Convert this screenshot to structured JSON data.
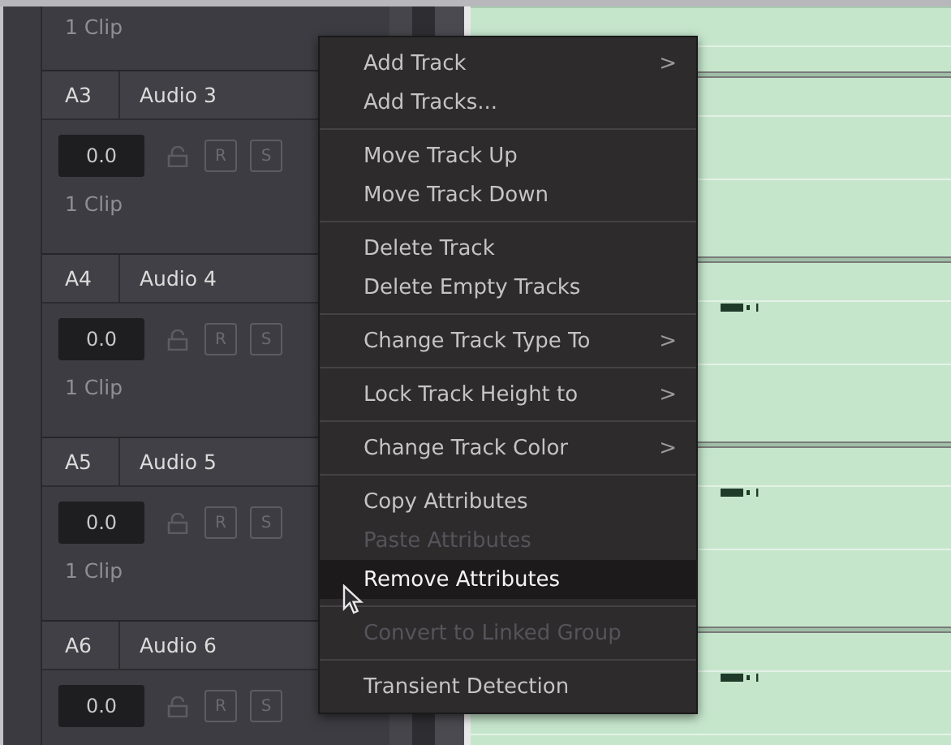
{
  "tracks": [
    {
      "clips": "1 Clip",
      "waveform": false
    },
    {
      "id": "A3",
      "name": "Audio 3",
      "volume": "0.0",
      "buttons": [
        "R",
        "S"
      ],
      "clips": "1 Clip",
      "waveform": false
    },
    {
      "id": "A4",
      "name": "Audio 4",
      "volume": "0.0",
      "buttons": [
        "R",
        "S"
      ],
      "clips": "1 Clip",
      "waveform": true
    },
    {
      "id": "A5",
      "name": "Audio 5",
      "volume": "0.0",
      "buttons": [
        "R",
        "S"
      ],
      "clips": "1 Clip",
      "waveform": true
    },
    {
      "id": "A6",
      "name": "Audio 6",
      "volume": "0.0",
      "buttons": [
        "R",
        "S"
      ],
      "waveform": true
    }
  ],
  "context_menu": {
    "groups": [
      [
        {
          "label": "Add Track",
          "submenu": ">",
          "disabled": false,
          "selected": false
        },
        {
          "label": "Add Tracks...",
          "disabled": false,
          "selected": false
        }
      ],
      [
        {
          "label": "Move Track Up",
          "disabled": false,
          "selected": false
        },
        {
          "label": "Move Track Down",
          "disabled": false,
          "selected": false
        }
      ],
      [
        {
          "label": "Delete Track",
          "disabled": false,
          "selected": false
        },
        {
          "label": "Delete Empty Tracks",
          "disabled": false,
          "selected": false
        }
      ],
      [
        {
          "label": "Change Track Type To",
          "submenu": ">",
          "disabled": false,
          "selected": false
        }
      ],
      [
        {
          "label": "Lock Track Height to",
          "submenu": ">",
          "disabled": false,
          "selected": false
        }
      ],
      [
        {
          "label": "Change Track Color",
          "submenu": ">",
          "disabled": false,
          "selected": false
        }
      ],
      [
        {
          "label": "Copy Attributes",
          "disabled": false,
          "selected": false
        },
        {
          "label": "Paste Attributes",
          "disabled": true,
          "selected": false
        },
        {
          "label": "Remove Attributes",
          "disabled": false,
          "selected": true
        }
      ],
      [
        {
          "label": "Convert to Linked Group",
          "disabled": true,
          "selected": false
        }
      ],
      [
        {
          "label": "Transient Detection",
          "disabled": false,
          "selected": false
        }
      ]
    ]
  }
}
